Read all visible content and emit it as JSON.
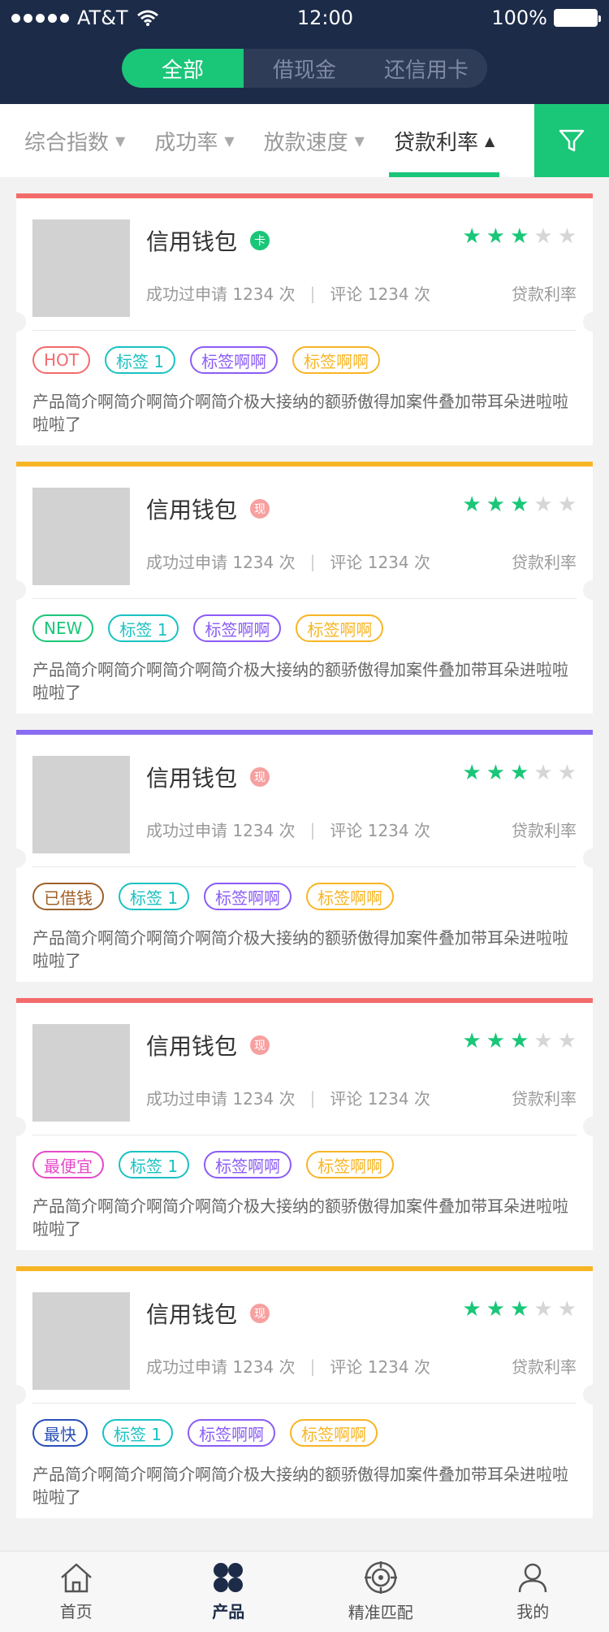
{
  "status_bar": {
    "carrier": "AT&T",
    "time": "12:00",
    "battery": "100%"
  },
  "segment": {
    "tabs": [
      "全部",
      "借现金",
      "还信用卡"
    ]
  },
  "filters": {
    "items": [
      "综合指数",
      "成功率",
      "放款速度",
      "贷款利率"
    ],
    "active_index": 3
  },
  "colors": {
    "primary": "#1ac678",
    "header_bg": "#1c2b48",
    "star_on": "#1ac678",
    "star_off": "#d6d6d6"
  },
  "cards": [
    {
      "title": "信用钱包",
      "badge": {
        "text": "卡",
        "color": "#1ac678"
      },
      "stars": 3,
      "stats": {
        "success": "成功过申请 1234 次",
        "comments": "评论 1234 次"
      },
      "rate_label": "贷款利率",
      "line_color": "#f36b6b",
      "tags": [
        {
          "text": "HOT",
          "color": "#f36b6b"
        },
        {
          "text": "标签 1",
          "color": "#1ac2c2"
        },
        {
          "text": "标签啊啊",
          "color": "#8b5cf6"
        },
        {
          "text": "标签啊啊",
          "color": "#f7b525"
        }
      ],
      "description": "产品简介啊简介啊简介啊简介极大接纳的额骄傲得加案件叠加带耳朵进啦啦啦啦了"
    },
    {
      "title": "信用钱包",
      "badge": {
        "text": "现",
        "color": "#f7a0a0"
      },
      "stars": 3,
      "stats": {
        "success": "成功过申请 1234 次",
        "comments": "评论 1234 次"
      },
      "rate_label": "贷款利率",
      "line_color": "#f7b525",
      "tags": [
        {
          "text": "NEW",
          "color": "#1ac678"
        },
        {
          "text": "标签 1",
          "color": "#1ac2c2"
        },
        {
          "text": "标签啊啊",
          "color": "#8b5cf6"
        },
        {
          "text": "标签啊啊",
          "color": "#f7b525"
        }
      ],
      "description": "产品简介啊简介啊简介啊简介极大接纳的额骄傲得加案件叠加带耳朵进啦啦啦啦了"
    },
    {
      "title": "信用钱包",
      "badge": {
        "text": "现",
        "color": "#f7a0a0"
      },
      "stars": 3,
      "stats": {
        "success": "成功过申请 1234 次",
        "comments": "评论 1234 次"
      },
      "rate_label": "贷款利率",
      "line_color": "#8a6bf2",
      "tags": [
        {
          "text": "已借钱",
          "color": "#a0602a"
        },
        {
          "text": "标签 1",
          "color": "#1ac2c2"
        },
        {
          "text": "标签啊啊",
          "color": "#8b5cf6"
        },
        {
          "text": "标签啊啊",
          "color": "#f7b525"
        }
      ],
      "description": "产品简介啊简介啊简介啊简介极大接纳的额骄傲得加案件叠加带耳朵进啦啦啦啦了"
    },
    {
      "title": "信用钱包",
      "badge": {
        "text": "现",
        "color": "#f7a0a0"
      },
      "stars": 3,
      "stats": {
        "success": "成功过申请 1234 次",
        "comments": "评论 1234 次"
      },
      "rate_label": "贷款利率",
      "line_color": "#f36b6b",
      "tags": [
        {
          "text": "最便宜",
          "color": "#e64ac8"
        },
        {
          "text": "标签 1",
          "color": "#1ac2c2"
        },
        {
          "text": "标签啊啊",
          "color": "#8b5cf6"
        },
        {
          "text": "标签啊啊",
          "color": "#f7b525"
        }
      ],
      "description": "产品简介啊简介啊简介啊简介极大接纳的额骄傲得加案件叠加带耳朵进啦啦啦啦了"
    },
    {
      "title": "信用钱包",
      "badge": {
        "text": "现",
        "color": "#f7a0a0"
      },
      "stars": 3,
      "stats": {
        "success": "成功过申请 1234 次",
        "comments": "评论 1234 次"
      },
      "rate_label": "贷款利率",
      "line_color": "#f7b525",
      "tags": [
        {
          "text": "最快",
          "color": "#2a4fb8"
        },
        {
          "text": "标签 1",
          "color": "#1ac2c2"
        },
        {
          "text": "标签啊啊",
          "color": "#8b5cf6"
        },
        {
          "text": "标签啊啊",
          "color": "#f7b525"
        }
      ],
      "description": "产品简介啊简介啊简介啊简介极大接纳的额骄傲得加案件叠加带耳朵进啦啦啦啦了"
    }
  ],
  "tabbar": {
    "items": [
      {
        "label": "首页",
        "icon": "home-icon"
      },
      {
        "label": "产品",
        "icon": "products-icon"
      },
      {
        "label": "精准匹配",
        "icon": "target-icon"
      },
      {
        "label": "我的",
        "icon": "user-icon"
      }
    ],
    "active_index": 1
  }
}
